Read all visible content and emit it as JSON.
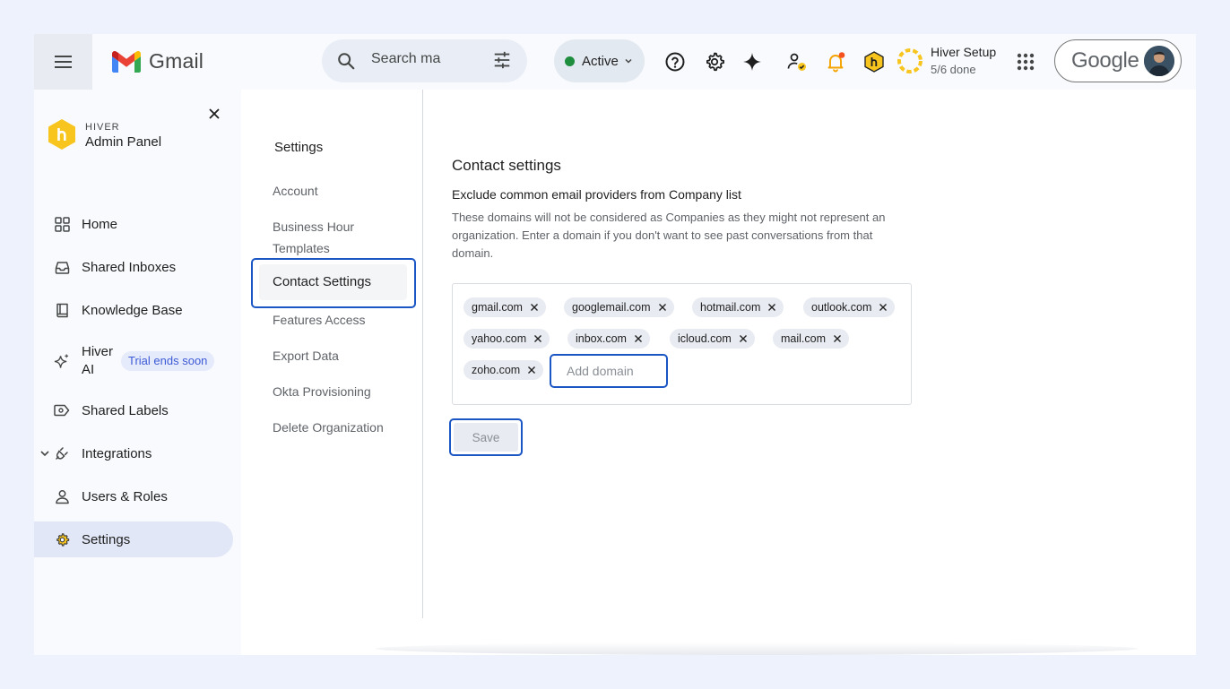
{
  "topbar": {
    "app_name": "Gmail",
    "search_placeholder": "Search ma",
    "status_label": "Active",
    "setup_title": "Hiver Setup",
    "setup_progress": "5/6 done",
    "google_label": "Google",
    "colors": {
      "status": "#1e8e3e",
      "notification_dot": "#f4511e",
      "hiver_yellow": "#f7c51e"
    }
  },
  "sidebar": {
    "brand_small": "HIVER",
    "brand_big": "Admin Panel",
    "items": [
      {
        "label": "Home",
        "icon": "grid-icon"
      },
      {
        "label": "Shared Inboxes",
        "icon": "inbox-icon"
      },
      {
        "label": "Knowledge Base",
        "icon": "book-icon"
      },
      {
        "label": "Hiver",
        "label2": "AI",
        "icon": "sparkle-icon",
        "badge": "Trial ends soon"
      },
      {
        "label": "Shared Labels",
        "icon": "label-icon"
      },
      {
        "label": "Integrations",
        "icon": "plug-icon"
      },
      {
        "label": "Users & Roles",
        "icon": "user-icon"
      },
      {
        "label": "Settings",
        "icon": "gear-icon",
        "active": true
      }
    ]
  },
  "settings_nav": {
    "title": "Settings",
    "items": [
      "Account",
      "Business Hour",
      "Templates",
      "Contact Settings",
      "Features Access",
      "Export Data",
      "Okta Provisioning",
      "Delete Organization"
    ],
    "active": "Contact Settings"
  },
  "panel": {
    "title": "Contact settings",
    "subtitle": "Exclude common email providers from Company list",
    "description": "These domains will not be considered as Companies as they might not represent an organization. Enter a domain if you don't want to see past conversations from that domain.",
    "domains": [
      "gmail.com",
      "googlemail.com",
      "hotmail.com",
      "outlook.com",
      "yahoo.com",
      "inbox.com",
      "icloud.com",
      "mail.com",
      "zoho.com"
    ],
    "add_placeholder": "Add domain",
    "save_label": "Save"
  }
}
